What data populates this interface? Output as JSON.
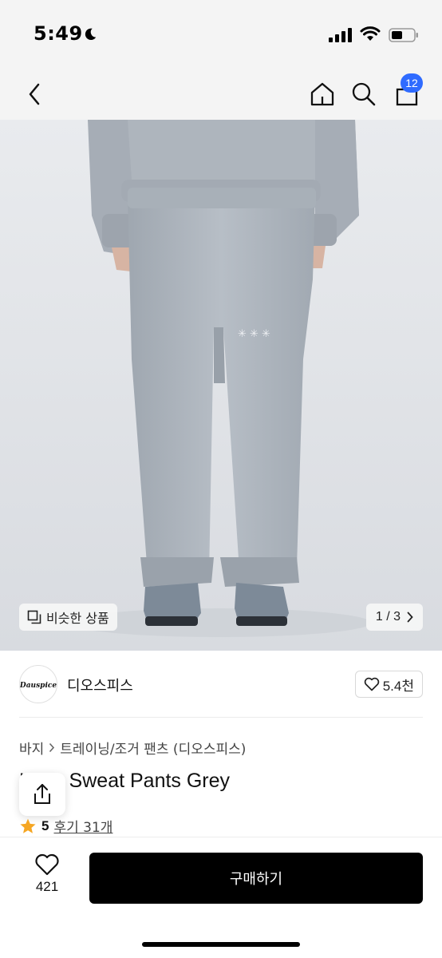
{
  "status_bar": {
    "time": "5:49",
    "icons": [
      "moon-icon",
      "signal-icon",
      "wifi-icon",
      "battery-icon"
    ]
  },
  "nav": {
    "icons": [
      "back-chevron-icon",
      "home-icon",
      "search-icon",
      "shopping-bag-icon"
    ],
    "cart_count": "12",
    "badge_color": "#2f6bff"
  },
  "gallery": {
    "similar_label": "비슷한 상품",
    "page_indicator": "1 / 3"
  },
  "brand": {
    "logo_text": "Dauspice",
    "name": "디오스피스",
    "likes": "5.4천"
  },
  "product": {
    "breadcrumb": [
      "바지",
      "트레이닝/조거 팬츠 (디오스피스)"
    ],
    "title": "Logo Sweat Pants Grey",
    "rating": "5",
    "reviews": "후기 31개",
    "star_color": "#f5a623"
  },
  "bottom_bar": {
    "wish_count": "421",
    "buy_label": "구매하기"
  }
}
